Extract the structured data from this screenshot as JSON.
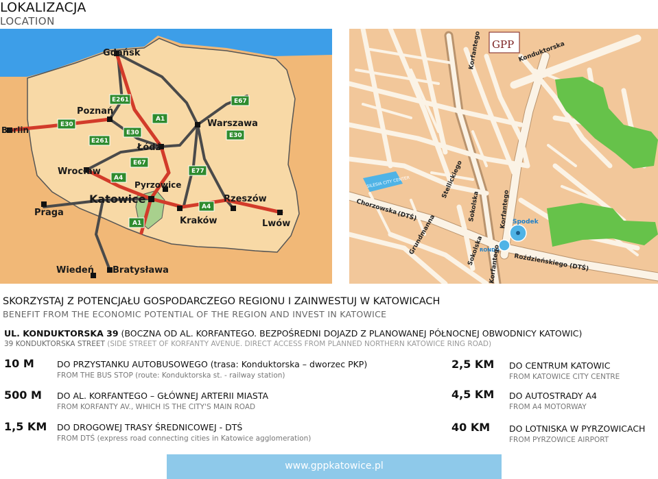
{
  "header": {
    "title": "LOKALIZACJA",
    "subtitle": "LOCATION"
  },
  "poland_map": {
    "cities": {
      "gdansk": "Gdańsk",
      "poznan": "Poznań",
      "berlin": "Berlin",
      "warszawa": "Warszawa",
      "lodz": "Łódź",
      "wroclaw": "Wrocław",
      "pyrzowice": "Pyrzowice",
      "katowice": "Katowice",
      "rzeszow": "Rzeszów",
      "krakow": "Kraków",
      "lwow": "Lwów",
      "praga": "Praga",
      "wieden": "Wiedeń",
      "bratyslawa": "Bratysława"
    },
    "roads": {
      "e30_west": "E30",
      "e261_north": "E261",
      "e261_west": "E261",
      "e30_mid": "E30",
      "a1_north": "A1",
      "e67_ne": "E67",
      "e30_east": "E30",
      "e67_sw": "E67",
      "a4_west": "A4",
      "e77": "E77",
      "a4_east": "A4",
      "a1_south": "A1"
    }
  },
  "city_map": {
    "logo": "GPP",
    "streets": {
      "korfantego_top": "Korfantego",
      "konduktorska": "Konduktorska",
      "chorzowska": "Chorzowska",
      "dts_left": "(DTŚ)",
      "stefanckiego": "Stellickiego",
      "sokolska_upper": "Sokolska",
      "korfantego_mid": "Korfantego",
      "grundmanna": "Grundmanna",
      "sokolska_lower": "Sokolska",
      "korfantego_bottom": "Korfantego",
      "rozdzienskiego": "Roździeńskiego (DTŚ)"
    },
    "landmarks": {
      "silesia_city_center": "SILESIA CITY CENTER",
      "spodek": "Spodek",
      "rondo": "RONDO"
    }
  },
  "benefit": {
    "pl": "SKORZYSTAJ Z POTENCJAŁU GOSPODARCZEGO REGIONU I ZAINWESTUJ W KATOWICACH",
    "en": "BENEFIT FROM THE ECONOMIC POTENTIAL OF THE REGION AND INVEST IN KATOWICE"
  },
  "address": {
    "pl_bold": "UL. KONDUKTORSKA 39",
    "pl_rest": " (BOCZNA OD AL. KORFANTEGO. BEZPOŚREDNI DOJAZD Z PLANOWANEJ PÓŁNOCNEJ OBWODNICY KATOWIC)",
    "en_street": "39 KONDUKTORSKA STREET",
    "en_rest": " (SIDE STREET OF KORFANTY AVENUE. DIRECT ACCESS FROM PLANNED NORTHERN KATOWICE RING ROAD)"
  },
  "distances_left": [
    {
      "value": "10 M",
      "pl": "DO PRZYSTANKU AUTOBUSOWEGO (trasa: Konduktorska – dworzec PKP)",
      "en": "FROM THE BUS STOP  (route: Konduktorska st. -  railway station)"
    },
    {
      "value": "500 M",
      "pl": "DO AL. KORFANTEGO – GŁÓWNEJ ARTERII MIASTA",
      "en": "FROM KORFANTY AV., WHICH IS THE CITY'S MAIN ROAD"
    },
    {
      "value": "1,5 KM",
      "pl": "DO DROGOWEJ TRASY ŚREDNICOWEJ - DTŚ",
      "en": "FROM DTŚ (express road connecting cities in Katowice agglomeration)"
    }
  ],
  "distances_right": [
    {
      "value": "2,5 KM",
      "pl": "DO CENTRUM KATOWIC",
      "en": "FROM KATOWICE CITY CENTRE"
    },
    {
      "value": "4,5 KM",
      "pl": "DO AUTOSTRADY A4",
      "en": "FROM A4 MOTORWAY"
    },
    {
      "value": "40 KM",
      "pl": "DO LOTNISKA W PYRZOWICACH",
      "en": "FROM PYRZOWICE AIRPORT"
    }
  ],
  "footer": {
    "url": "www.gppkatowice.pl"
  },
  "colors": {
    "sea": "#3d9ee8",
    "land": "#f8d9a6",
    "neighbor_land": "#f1b877",
    "motorway": "#d23b2a",
    "road": "#4a4a4a",
    "badge": "#2e8b2e",
    "silesia_region": "#a8d08d",
    "city_bg": "#f2c79a",
    "street_fill": "#fbf3e6",
    "park": "#66c24a",
    "footer_bar": "#8ec9ea"
  }
}
